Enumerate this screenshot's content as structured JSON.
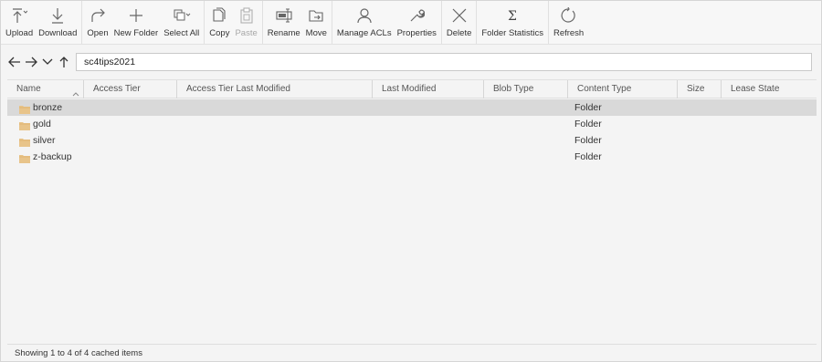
{
  "toolbar": {
    "groups": [
      [
        {
          "label": "Upload",
          "icon": "upload-icon",
          "disabled": false
        },
        {
          "label": "Download",
          "icon": "download-icon",
          "disabled": false
        }
      ],
      [
        {
          "label": "Open",
          "icon": "open-icon",
          "disabled": false
        },
        {
          "label": "New Folder",
          "icon": "new-folder-icon",
          "disabled": false
        },
        {
          "label": "Select All",
          "icon": "select-all-icon",
          "disabled": false
        }
      ],
      [
        {
          "label": "Copy",
          "icon": "copy-icon",
          "disabled": false
        },
        {
          "label": "Paste",
          "icon": "paste-icon",
          "disabled": true
        }
      ],
      [
        {
          "label": "Rename",
          "icon": "rename-icon",
          "disabled": false
        },
        {
          "label": "Move",
          "icon": "move-icon",
          "disabled": false
        }
      ],
      [
        {
          "label": "Manage ACLs",
          "icon": "manage-acls-icon",
          "disabled": false
        },
        {
          "label": "Properties",
          "icon": "properties-icon",
          "disabled": false
        }
      ],
      [
        {
          "label": "Delete",
          "icon": "delete-icon",
          "disabled": false
        }
      ],
      [
        {
          "label": "Folder Statistics",
          "icon": "folder-statistics-icon",
          "disabled": false
        }
      ],
      [
        {
          "label": "Refresh",
          "icon": "refresh-icon",
          "disabled": false
        }
      ]
    ]
  },
  "nav": {
    "address": "sc4tips2021"
  },
  "table": {
    "columns": [
      "Name",
      "Access Tier",
      "Access Tier Last Modified",
      "Last Modified",
      "Blob Type",
      "Content Type",
      "Size",
      "Lease State"
    ],
    "rows": [
      {
        "name": "bronze",
        "content_type": "Folder",
        "selected": true
      },
      {
        "name": "gold",
        "content_type": "Folder",
        "selected": false
      },
      {
        "name": "silver",
        "content_type": "Folder",
        "selected": false
      },
      {
        "name": "z-backup",
        "content_type": "Folder",
        "selected": false
      }
    ]
  },
  "status": {
    "text": "Showing 1 to 4 of 4 cached items"
  },
  "colors": {
    "folder": "#e8c48a",
    "selected_row": "#d9d9d9",
    "icon_stroke": "#666666"
  }
}
